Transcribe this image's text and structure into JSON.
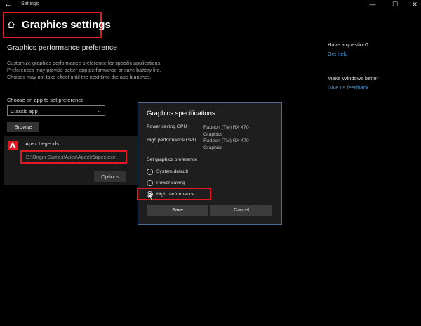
{
  "window": {
    "title": "Settings",
    "controls": [
      "—",
      "☐",
      "✕"
    ],
    "back_icon": "back-arrow-icon"
  },
  "header": {
    "title": "Graphics settings",
    "icon": "home-icon"
  },
  "main": {
    "section_title": "Graphics performance preference",
    "description": "Customize graphics performance preference for specific applications. Preferences may provide better app performance or save battery life. Choices may not take effect until the next time the app launches.",
    "choose_label": "Choose an app to set preference",
    "app_type_select": {
      "value": "Classic app"
    },
    "browse_label": "Browse",
    "app_entry": {
      "name": "Apex Legends",
      "path": "D:\\Origin Games\\Apex\\Apex\\r5apex.exe",
      "options_label": "Options"
    }
  },
  "right_panel": {
    "question_title": "Have a question?",
    "help_link": "Get help",
    "better_title": "Make Windows better",
    "feedback_link": "Give us feedback"
  },
  "dialog": {
    "title": "Graphics specifications",
    "power_saving_gpu_label": "Power saving GPU",
    "power_saving_gpu_value": "Radeon (TM) RX 470 Graphics",
    "high_performance_gpu_label": "High performance GPU",
    "high_performance_gpu_value": "Radeon (TM) RX 470 Graphics",
    "preference_label": "Set graphics preference",
    "options": [
      "System default",
      "Power saving",
      "High performance"
    ],
    "selected_option": "High performance",
    "save_label": "Save",
    "cancel_label": "Cancel"
  },
  "colors": {
    "background": "#000000",
    "dialog_bg": "#1e1e1e",
    "dialog_border": "#4b6d93",
    "highlight_red": "#e21822",
    "link_blue": "#4a9ad6"
  }
}
